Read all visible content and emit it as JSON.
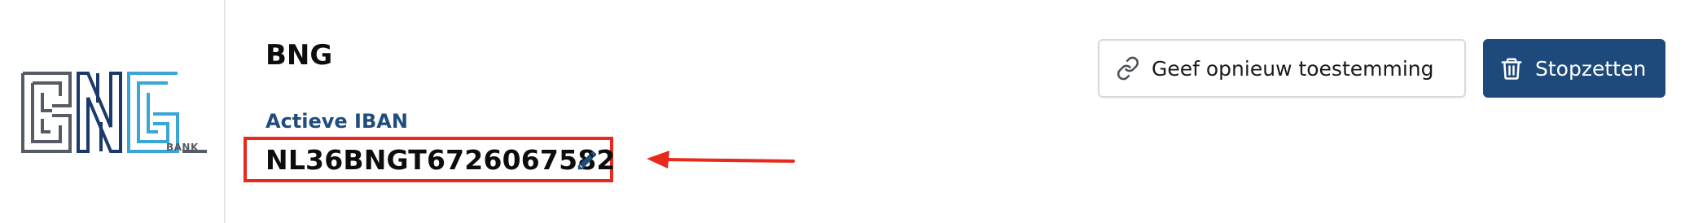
{
  "logo": {
    "caption": "BANK"
  },
  "bank": {
    "name": "BNG"
  },
  "iban": {
    "label": "Actieve IBAN",
    "value": "NL36BNGT6726067582"
  },
  "actions": {
    "reconsent_label": "Geef opnieuw toestemming",
    "stop_label": "Stopzetten"
  },
  "icons": {
    "reconsent": "link-icon",
    "stop": "trash-icon",
    "edit": "pencil-icon"
  },
  "colors": {
    "brand_blue": "#1d4a7a",
    "label_blue": "#1f4d7c",
    "highlight_red": "#e8291c",
    "logo_grey": "#555c66",
    "logo_navy": "#1b3a6b",
    "logo_cyan": "#3aa6d8"
  }
}
